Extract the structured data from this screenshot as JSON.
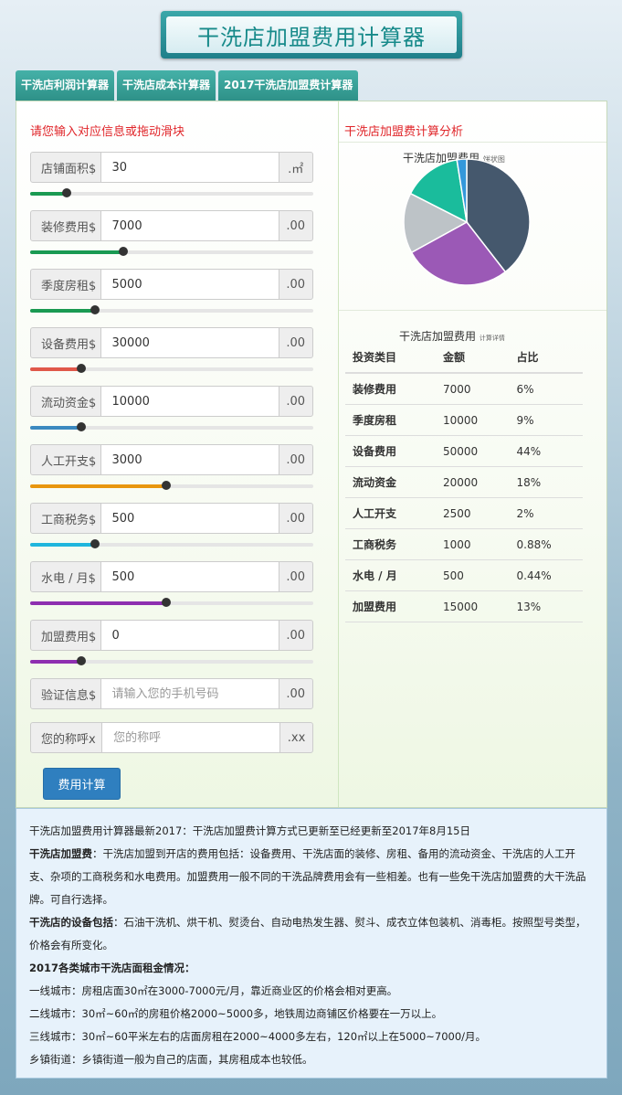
{
  "title": "干洗店加盟费用计算器",
  "tabs": [
    "干洗店利润计算器",
    "干洗店成本计算器",
    "2017干洗店加盟费计算器"
  ],
  "left_title": "请您输入对应信息或拖动滑块",
  "right_title": "干洗店加盟费计算分析",
  "fields": [
    {
      "label": "店铺面积$",
      "value": "30",
      "unit": ".㎡",
      "slider_color": "#1a9a52",
      "slider_fraction": 0.13
    },
    {
      "label": "装修费用$",
      "value": "7000",
      "unit": ".00",
      "slider_color": "#1a9a52",
      "slider_fraction": 0.33
    },
    {
      "label": "季度房租$",
      "value": "5000",
      "unit": ".00",
      "slider_color": "#1a9a52",
      "slider_fraction": 0.23
    },
    {
      "label": "设备费用$",
      "value": "30000",
      "unit": ".00",
      "slider_color": "#e0584a",
      "slider_fraction": 0.18
    },
    {
      "label": "流动资金$",
      "value": "10000",
      "unit": ".00",
      "slider_color": "#3b89c0",
      "slider_fraction": 0.18
    },
    {
      "label": "人工开支$",
      "value": "3000",
      "unit": ".00",
      "slider_color": "#e8960e",
      "slider_fraction": 0.48
    },
    {
      "label": "工商税务$",
      "value": "500",
      "unit": ".00",
      "slider_color": "#1fb6dd",
      "slider_fraction": 0.23
    },
    {
      "label": "水电 / 月$",
      "value": "500",
      "unit": ".00",
      "slider_color": "#8e2fb0",
      "slider_fraction": 0.48
    },
    {
      "label": "加盟费用$",
      "value": "0",
      "unit": ".00",
      "slider_color": "#8e2fb0",
      "slider_fraction": 0.18
    }
  ],
  "verify": {
    "label": "验证信息$",
    "placeholder": "请输入您的手机号码",
    "unit": ".00"
  },
  "name_field": {
    "label": "您的称呼x",
    "placeholder": "您的称呼",
    "unit": ".xx"
  },
  "submit_label": "费用计算",
  "pie": {
    "title": "干洗店加盟费用",
    "subtitle": "饼状图",
    "slices": [
      {
        "value": 39.5,
        "color": "#45586d"
      },
      {
        "value": 27.5,
        "color": "#9b59b6"
      },
      {
        "value": 15.5,
        "color": "#bdc3c7"
      },
      {
        "value": 15.0,
        "color": "#1abc9c"
      },
      {
        "value": 2.5,
        "color": "#3498db"
      }
    ]
  },
  "detail": {
    "title": "干洗店加盟费用",
    "subtitle": "计算详情",
    "headers": [
      "投资类目",
      "金额",
      "占比"
    ],
    "rows": [
      [
        "装修费用",
        "7000",
        "6%"
      ],
      [
        "季度房租",
        "10000",
        "9%"
      ],
      [
        "设备费用",
        "50000",
        "44%"
      ],
      [
        "流动资金",
        "20000",
        "18%"
      ],
      [
        "人工开支",
        "2500",
        "2%"
      ],
      [
        "工商税务",
        "1000",
        "0.88%"
      ],
      [
        "水电 / 月",
        "500",
        "0.44%"
      ],
      [
        "加盟费用",
        "15000",
        "13%"
      ]
    ]
  },
  "info": {
    "line1": "干洗店加盟费用计算器最新2017：干洗店加盟费计算方式已更新至已经更新至2017年8月15日",
    "p2_bold": "干洗店加盟费",
    "p2_text": "：干洗店加盟到开店的费用包括：设备费用、干洗店面的装修、房租、备用的流动资金、干洗店的人工开支、杂项的工商税务和水电费用。加盟费用一般不同的干洗品牌费用会有一些相差。也有一些免干洗店加盟费的大干洗品牌。可自行选择。",
    "p3_bold": "干洗店的设备包括",
    "p3_text": "：石油干洗机、烘干机、熨烫台、自动电热发生器、熨斗、成衣立体包装机、消毒柜。按照型号类型，价格会有所变化。",
    "p4_bold": "2017各类城市干洗店面租金情况：",
    "city1": "一线城市：房租店面30㎡在3000-7000元/月，靠近商业区的价格会相对更高。",
    "city2": "二线城市：30㎡~60㎡的房租价格2000~5000多，地铁周边商铺区价格要在一万以上。",
    "city3": "三线城市：30㎡~60平米左右的店面房租在2000~4000多左右，120㎡以上在5000~7000/月。",
    "city4": "乡镇街道：乡镇街道一般为自己的店面，其房租成本也较低。"
  }
}
